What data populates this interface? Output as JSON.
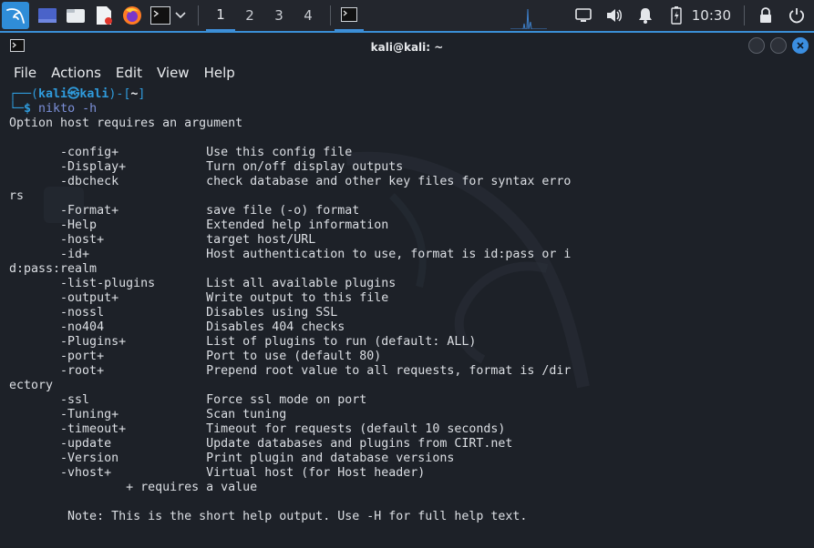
{
  "panel": {
    "workspaces": [
      "1",
      "2",
      "3",
      "4"
    ],
    "active_workspace": "1",
    "clock": "10:30",
    "icons": [
      "kali-menu-icon",
      "show-desktop-icon",
      "file-manager-icon",
      "text-editor-icon",
      "firefox-icon",
      "terminal-icon",
      "chevron-down-icon",
      "terminal-task-icon",
      "display-icon",
      "volume-icon",
      "notification-bell-icon",
      "battery-icon",
      "lock-icon",
      "power-icon"
    ]
  },
  "window": {
    "title": "kali@kali: ~",
    "menu": [
      "File",
      "Actions",
      "Edit",
      "View",
      "Help"
    ]
  },
  "terminal": {
    "prompt": {
      "frame_top": "┌──(",
      "user": "kali㉿kali",
      "mid": ")-[",
      "dir": "~",
      "end": "]",
      "frame_bottom": "└─",
      "dollar": "$",
      "command": "nikto",
      "arg": "-h"
    },
    "lines": [
      "Option host requires an argument",
      "",
      "       -config+            Use this config file",
      "       -Display+           Turn on/off display outputs",
      "       -dbcheck            check database and other key files for syntax erro",
      "rs",
      "       -Format+            save file (-o) format",
      "       -Help               Extended help information",
      "       -host+              target host/URL",
      "       -id+                Host authentication to use, format is id:pass or i",
      "d:pass:realm",
      "       -list-plugins       List all available plugins",
      "       -output+            Write output to this file",
      "       -nossl              Disables using SSL",
      "       -no404              Disables 404 checks",
      "       -Plugins+           List of plugins to run (default: ALL)",
      "       -port+              Port to use (default 80)",
      "       -root+              Prepend root value to all requests, format is /dir",
      "ectory",
      "       -ssl                Force ssl mode on port",
      "       -Tuning+            Scan tuning",
      "       -timeout+           Timeout for requests (default 10 seconds)",
      "       -update             Update databases and plugins from CIRT.net",
      "       -Version            Print plugin and database versions",
      "       -vhost+             Virtual host (for Host header)",
      "                + requires a value",
      "",
      "        Note: This is the short help output. Use -H for full help text."
    ]
  }
}
